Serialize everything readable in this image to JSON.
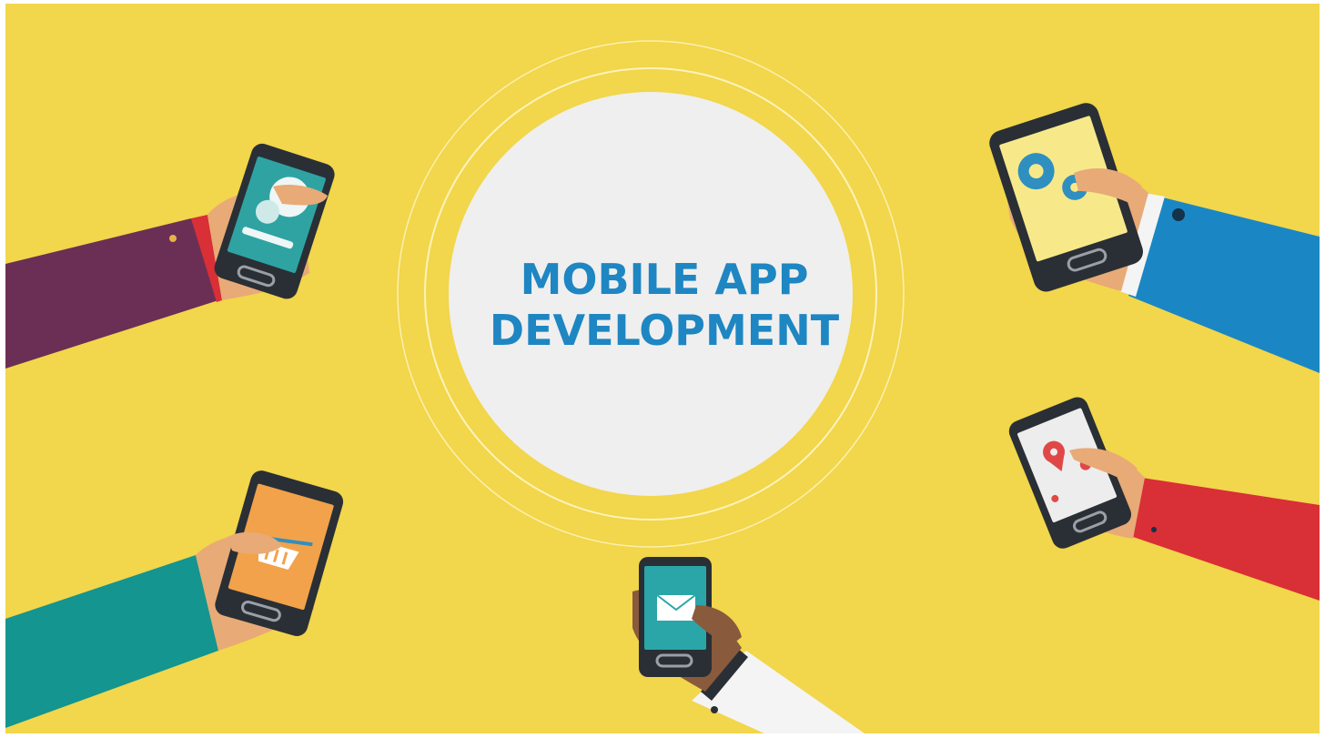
{
  "hero": {
    "title_line1": "MOBILE APP",
    "title_line2": "DEVELOPMENT"
  },
  "colors": {
    "background": "#F2D64B",
    "circle": "#EFEFEF",
    "title": "#1E86C2",
    "sleeve_purple": "#6B2F55",
    "sleeve_blue": "#1A87C4",
    "sleeve_teal": "#14958F",
    "sleeve_red": "#D92F36",
    "sleeve_white": "#F4F4F4",
    "skin": "#E8AA77"
  },
  "phones": [
    {
      "screen_color": "#2EA3A2",
      "icon": "chat-bubble-icon"
    },
    {
      "screen_color": "#F7E98A",
      "icon": "gears-icon"
    },
    {
      "screen_color": "#F2A24A",
      "icon": "shopping-basket-icon"
    },
    {
      "screen_color": "#2AA6A8",
      "icon": "envelope-icon"
    },
    {
      "screen_color": "#EDEDED",
      "icon": "map-pin-icon"
    }
  ]
}
